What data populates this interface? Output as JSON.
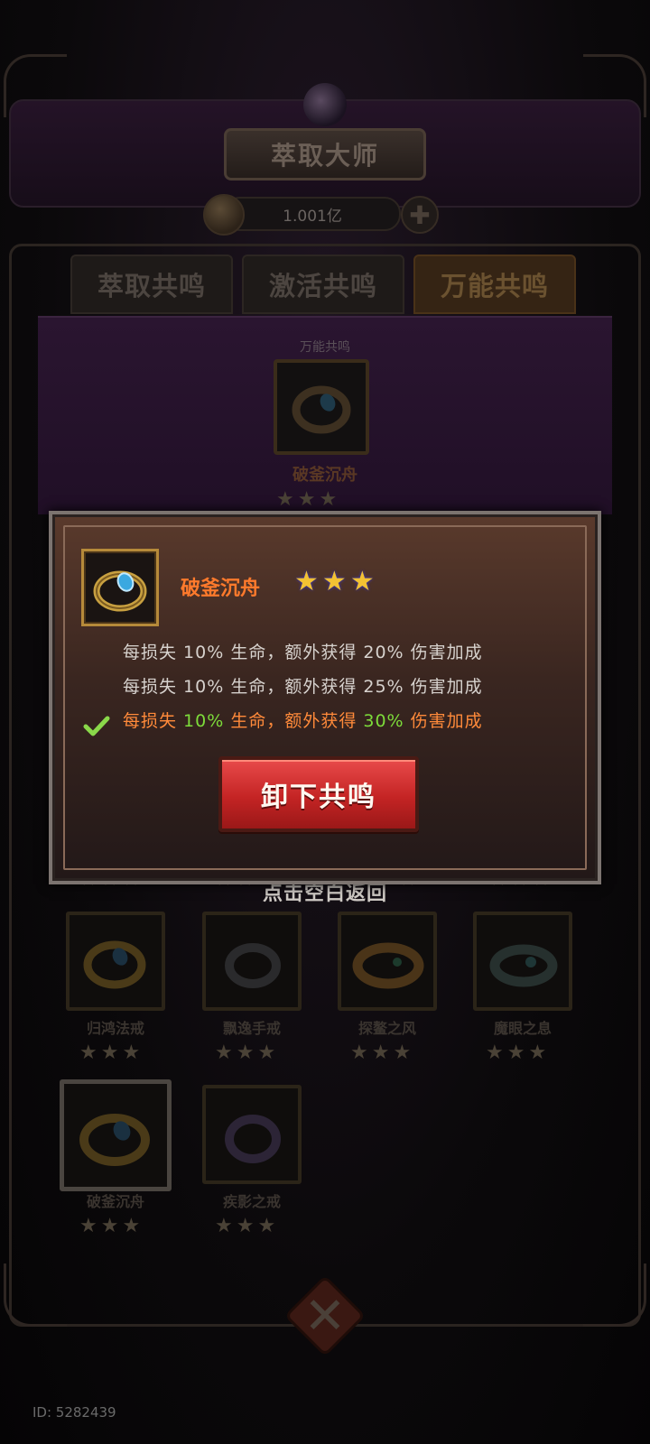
{
  "header": {
    "title": "萃取大师",
    "currency_value": "1.001亿",
    "plus_icon": "plus-icon",
    "coin_icon": "coin-icon"
  },
  "tabs": [
    {
      "label": "萃取共鸣",
      "active": false
    },
    {
      "label": "激活共鸣",
      "active": false
    },
    {
      "label": "万能共鸣",
      "active": true
    }
  ],
  "slot": {
    "section_label": "万能共鸣",
    "equipped_name": "破釜沉舟",
    "stars": 3
  },
  "popup": {
    "item_name": "破釜沉舟",
    "stars": 3,
    "effects": [
      {
        "prefix": "每损失 ",
        "v1": "10%",
        "mid": " 生命，额外获得 ",
        "v2": "20%",
        "suffix": " 伤害加成",
        "active": false
      },
      {
        "prefix": "每损失 ",
        "v1": "10%",
        "mid": " 生命，额外获得 ",
        "v2": "25%",
        "suffix": " 伤害加成",
        "active": false
      },
      {
        "prefix": "每损失 ",
        "v1": "10%",
        "mid": " 生命，额外获得 ",
        "v2": "30%",
        "suffix": " 伤害加成",
        "active": true
      }
    ],
    "button_label": "卸下共鸣"
  },
  "hint": "点击空白返回",
  "grid": [
    {
      "name": "归鸿法戒",
      "stars": 3
    },
    {
      "name": "飘逸手戒",
      "stars": 3
    },
    {
      "name": "探鳌之风",
      "stars": 3
    },
    {
      "name": "魔眼之息",
      "stars": 3
    },
    {
      "name": "破釜沉舟",
      "stars": 3,
      "selected": true
    },
    {
      "name": "疾影之戒",
      "stars": 3
    }
  ],
  "footer": {
    "id_text": "ID: 5282439"
  },
  "colors": {
    "accent_orange": "#ff7a2c",
    "highlight_green": "#7ddc3a",
    "button_red": "#c42424",
    "star_gold": "#f3c233"
  }
}
